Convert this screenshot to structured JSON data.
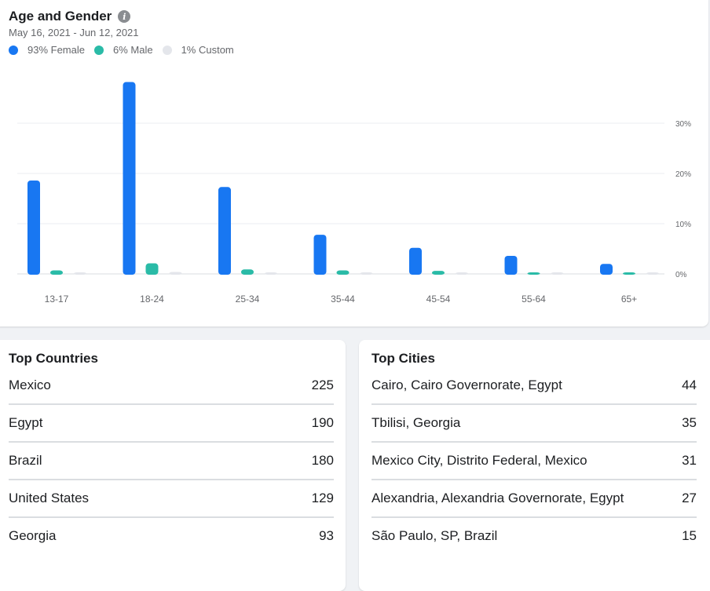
{
  "age_gender": {
    "title": "Age and Gender",
    "info_icon": "info-icon",
    "date_range": "May 16, 2021 - Jun 12, 2021",
    "legend": [
      {
        "label": "93% Female",
        "color": "#1877f2"
      },
      {
        "label": "6% Male",
        "color": "#2abba7"
      },
      {
        "label": "1% Custom",
        "color": "#e4e6eb"
      }
    ]
  },
  "chart_data": {
    "type": "bar",
    "categories": [
      "13-17",
      "18-24",
      "25-34",
      "35-44",
      "45-54",
      "55-64",
      "65+"
    ],
    "series": [
      {
        "name": "Female",
        "color": "#1877f2",
        "values": [
          18.6,
          38.2,
          17.3,
          7.8,
          5.2,
          3.6,
          2.0
        ]
      },
      {
        "name": "Male",
        "color": "#2abba7",
        "values": [
          0.7,
          2.1,
          0.9,
          0.7,
          0.6,
          0.2,
          0.3
        ]
      },
      {
        "name": "Custom",
        "color": "#e4e6eb",
        "values": [
          0.1,
          0.4,
          0.1,
          0.0,
          0.0,
          0.0,
          0.0
        ]
      }
    ],
    "y_ticks": [
      "0%",
      "10%",
      "20%",
      "30%"
    ],
    "y_tick_values": [
      0,
      10,
      20,
      30
    ],
    "ylim": [
      0,
      30
    ],
    "y_axis_side": "right",
    "grid": true
  },
  "top_countries": {
    "title": "Top Countries",
    "rows": [
      {
        "name": "Mexico",
        "value": "225"
      },
      {
        "name": "Egypt",
        "value": "190"
      },
      {
        "name": "Brazil",
        "value": "180"
      },
      {
        "name": "United States",
        "value": "129"
      },
      {
        "name": "Georgia",
        "value": "93"
      }
    ]
  },
  "top_cities": {
    "title": "Top Cities",
    "rows": [
      {
        "name": "Cairo, Cairo Governorate, Egypt",
        "value": "44"
      },
      {
        "name": "Tbilisi, Georgia",
        "value": "35"
      },
      {
        "name": "Mexico City, Distrito Federal, Mexico",
        "value": "31"
      },
      {
        "name": "Alexandria, Alexandria Governorate, Egypt",
        "value": "27"
      },
      {
        "name": "São Paulo, SP, Brazil",
        "value": "15"
      }
    ]
  }
}
